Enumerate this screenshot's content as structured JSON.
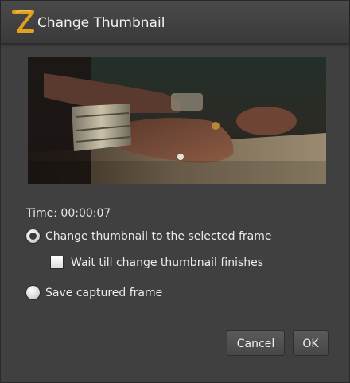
{
  "window": {
    "title": "Change Thumbnail",
    "logo_icon": "z-logo-icon"
  },
  "preview": {
    "image": "video-frame-thumbnail"
  },
  "time": {
    "text": "Time: 00:00:07"
  },
  "options": {
    "change_thumbnail_label": "Change thumbnail to the selected frame",
    "change_thumbnail_checked": true,
    "wait_label": "Wait till change thumbnail finishes",
    "wait_checked": false,
    "save_frame_label": "Save captured frame",
    "save_frame_checked": false
  },
  "buttons": {
    "cancel_label": "Cancel",
    "ok_label": "OK"
  },
  "colors": {
    "logo": "#e0a21c",
    "background": "#404040"
  }
}
